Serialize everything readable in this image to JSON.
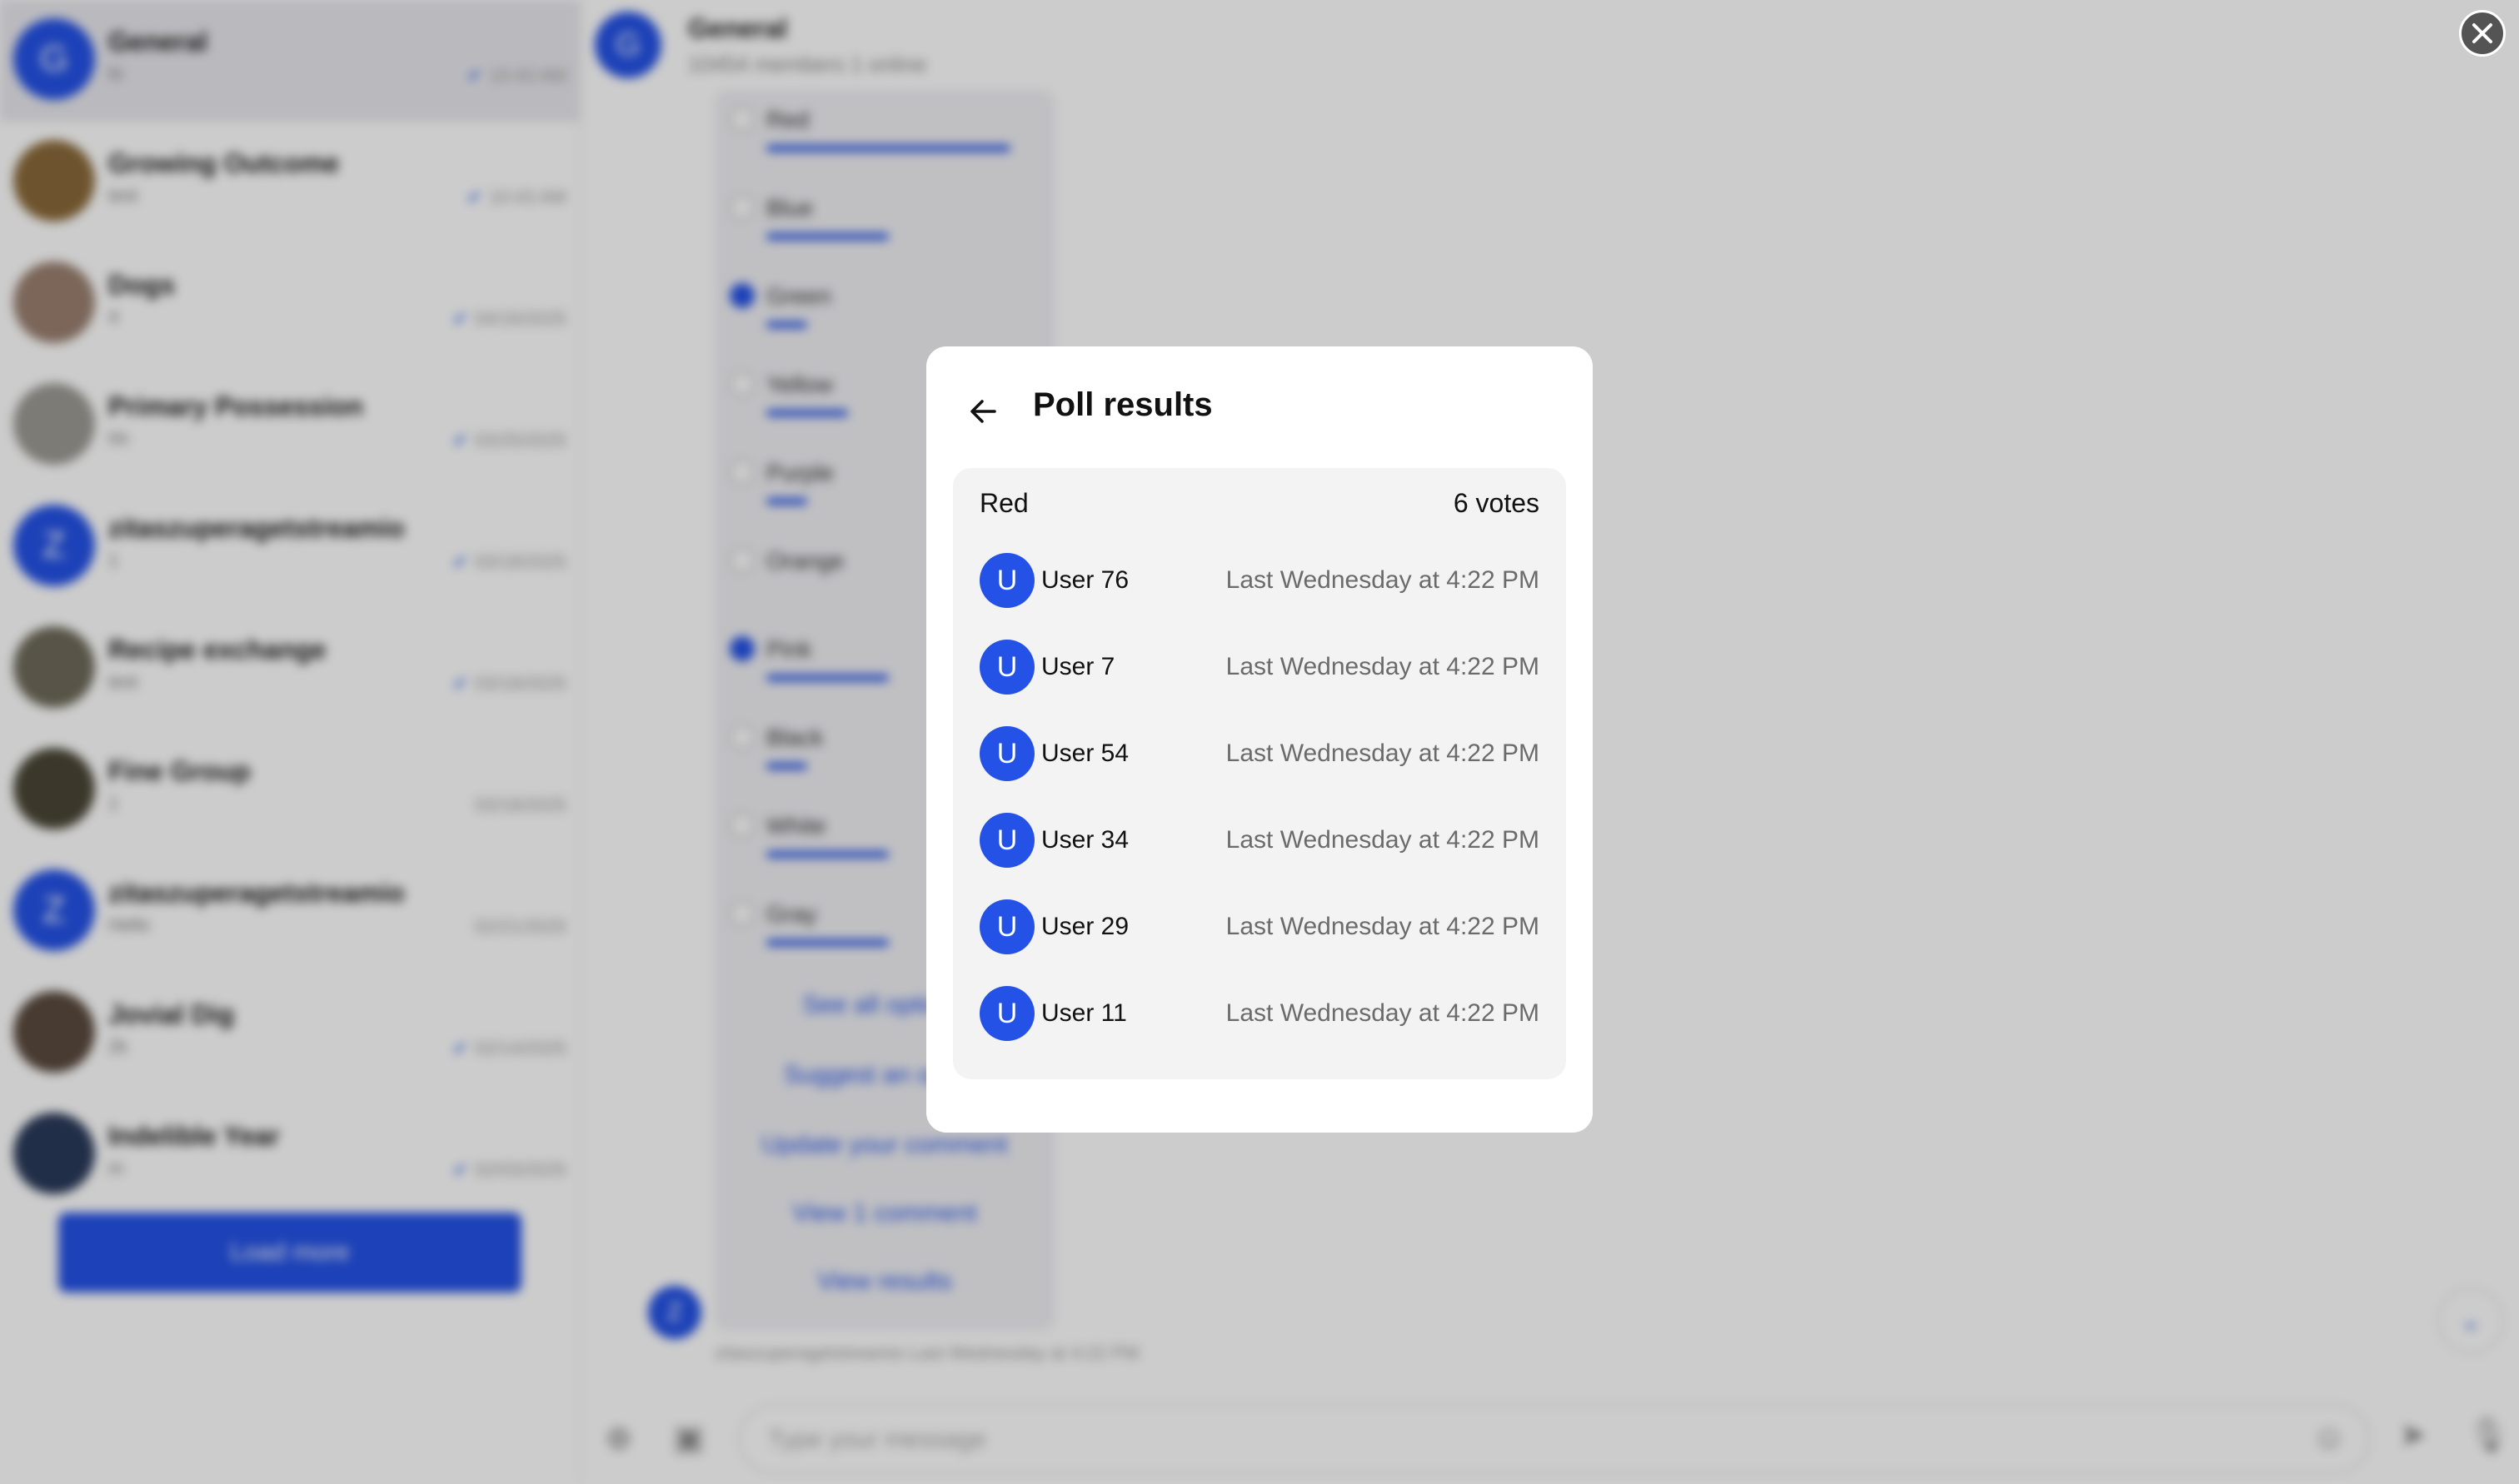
{
  "sidebar": {
    "chats": [
      {
        "name": "General",
        "preview": "hi",
        "time": "10:43 AM",
        "avatar_letter": "G",
        "avatar_color": "#2452e6",
        "read": true,
        "active": true
      },
      {
        "name": "Growing Outcome",
        "preview": "test",
        "time": "10:43 AM",
        "avatar_letter": "",
        "avatar_color": "#8a6a3a",
        "read": true,
        "active": false
      },
      {
        "name": "Dogs",
        "preview": "4",
        "time": "04/16/2025",
        "avatar_letter": "",
        "avatar_color": "#9a8070",
        "read": true,
        "active": false
      },
      {
        "name": "Primary Possession",
        "preview": "hh",
        "time": "03/25/2025",
        "avatar_letter": "",
        "avatar_color": "#9c9a94",
        "read": true,
        "active": false
      },
      {
        "name": "zitaszuperagetstreamio",
        "preview": "1",
        "time": "03/18/2025",
        "avatar_letter": "Z",
        "avatar_color": "#2452e6",
        "read": true,
        "active": false
      },
      {
        "name": "Recipe exchange",
        "preview": "test",
        "time": "03/18/2025",
        "avatar_letter": "",
        "avatar_color": "#6e6a5a",
        "read": true,
        "active": false
      },
      {
        "name": "Fine Group",
        "preview": "1",
        "time": "03/18/2025",
        "avatar_letter": "",
        "avatar_color": "#4a4636",
        "read": false,
        "active": false
      },
      {
        "name": "zitaszuperagetstreamio",
        "preview": "Hello",
        "time": "02/21/2025",
        "avatar_letter": "Z",
        "avatar_color": "#2452e6",
        "read": false,
        "active": false
      },
      {
        "name": "Jovial Dig",
        "preview": "2k",
        "time": "02/14/2025",
        "avatar_letter": "",
        "avatar_color": "#5a4a3e",
        "read": true,
        "active": false
      },
      {
        "name": "Indelible Year",
        "preview": "m",
        "time": "02/03/2025",
        "avatar_letter": "",
        "avatar_color": "#2a3a5a",
        "read": true,
        "active": false
      }
    ],
    "load_more_label": "Load more"
  },
  "chat": {
    "avatar_letter": "G",
    "title": "General",
    "subtitle": "10454 members 1 online",
    "poll_options": [
      {
        "label": "Red",
        "fraction": 0.9,
        "checked": false
      },
      {
        "label": "Blue",
        "fraction": 0.45,
        "checked": false
      },
      {
        "label": "Green",
        "fraction": 0.15,
        "checked": true
      },
      {
        "label": "Yellow",
        "fraction": 0.3,
        "checked": false
      },
      {
        "label": "Purple",
        "fraction": 0.15,
        "checked": false
      },
      {
        "label": "Orange",
        "fraction": 0,
        "checked": false
      },
      {
        "label": "Pink",
        "fraction": 0.45,
        "checked": true
      },
      {
        "label": "Black",
        "fraction": 0.15,
        "checked": false
      },
      {
        "label": "White",
        "fraction": 0.45,
        "checked": false
      },
      {
        "label": "Gray",
        "fraction": 0.45,
        "checked": false
      }
    ],
    "see_all_options": "See all options",
    "suggest_option": "Suggest an option",
    "update_comment": "Update your comment",
    "view_comments": "View 1 comment",
    "view_results": "View results",
    "sender_avatar_letter": "Z",
    "sender_meta": "zitaszuperagetstreamio Last Wednesday at 4:22 PM",
    "composer_placeholder": "Type your message"
  },
  "modal": {
    "title": "Poll results",
    "option_name": "Red",
    "vote_count": "6 votes",
    "voters": [
      {
        "initial": "U",
        "name": "User 76",
        "time": "Last Wednesday at 4:22 PM"
      },
      {
        "initial": "U",
        "name": "User 7",
        "time": "Last Wednesday at 4:22 PM"
      },
      {
        "initial": "U",
        "name": "User 54",
        "time": "Last Wednesday at 4:22 PM"
      },
      {
        "initial": "U",
        "name": "User 34",
        "time": "Last Wednesday at 4:22 PM"
      },
      {
        "initial": "U",
        "name": "User 29",
        "time": "Last Wednesday at 4:22 PM"
      },
      {
        "initial": "U",
        "name": "User 11",
        "time": "Last Wednesday at 4:22 PM"
      }
    ]
  },
  "colors": {
    "accent": "#2452e6",
    "overlay": "rgba(0,0,0,0.20)",
    "card_bg": "#f3f3f3"
  }
}
